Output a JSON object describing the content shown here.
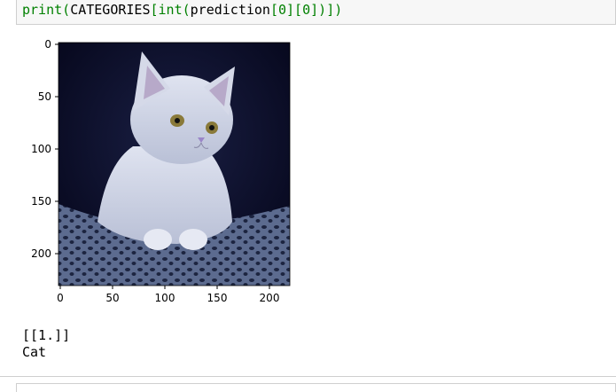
{
  "code_cell": {
    "tokens": [
      "print",
      "(",
      "CATEGORIES",
      "[",
      "int",
      "(",
      "prediction",
      "[",
      "0",
      "][",
      "0",
      "]",
      ")",
      "]",
      ")"
    ]
  },
  "plot": {
    "y_ticks": [
      "0",
      "50",
      "100",
      "150",
      "200"
    ],
    "x_ticks": [
      "0",
      "50",
      "100",
      "150",
      "200"
    ],
    "image_description": "cat-photo"
  },
  "output": {
    "line1": "[[1.]]",
    "line2": "Cat"
  }
}
